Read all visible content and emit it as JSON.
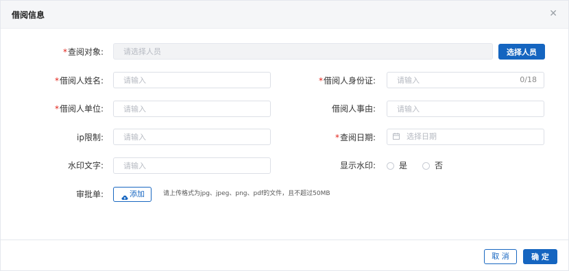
{
  "dialog": {
    "title": "借阅信息",
    "close_icon": "close-icon"
  },
  "form": {
    "required_mark": "*",
    "query_target": {
      "label": "查阅对象:",
      "placeholder": "请选择人员",
      "button": "选择人员"
    },
    "borrower_name": {
      "label": "借阅人姓名:",
      "placeholder": "请输入"
    },
    "borrower_id": {
      "label": "借阅人身份证:",
      "placeholder": "请输入",
      "counter": "0/18"
    },
    "borrower_unit": {
      "label": "借阅人单位:",
      "placeholder": "请输入"
    },
    "borrower_reason": {
      "label": "借阅人事由:",
      "placeholder": "请输入"
    },
    "ip_limit": {
      "label": "ip限制:",
      "placeholder": "请输入"
    },
    "query_date": {
      "label": "查阅日期:",
      "placeholder": "选择日期",
      "icon": "calendar-icon"
    },
    "watermark_text": {
      "label": "水印文字:",
      "placeholder": "请输入"
    },
    "show_watermark": {
      "label": "显示水印:",
      "options": [
        "是",
        "否"
      ]
    },
    "approval": {
      "label": "审批单:",
      "button": "添加",
      "icon": "cloud-upload-icon",
      "hint": "请上传格式为jpg、jpeg、png、pdf的文件，且不超过50MB"
    }
  },
  "footer": {
    "cancel": "取 消",
    "confirm": "确 定"
  },
  "colors": {
    "primary": "#1565c0",
    "required": "#e2231a",
    "header_bg": "#f5f6f8"
  }
}
